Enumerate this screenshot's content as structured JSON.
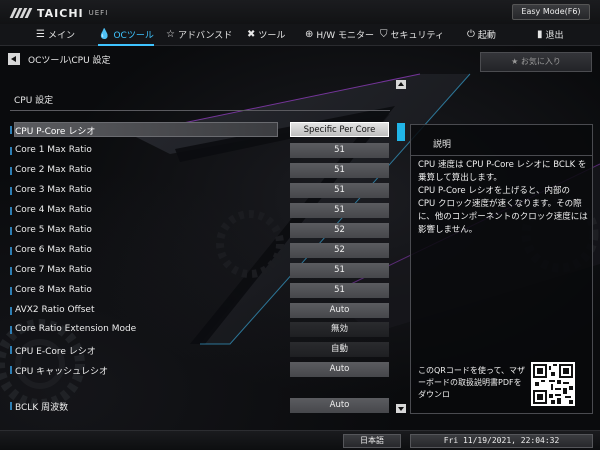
{
  "header": {
    "brand": "TAICHI",
    "brand_sub": "UEFI",
    "easy_mode_label": "Easy Mode(F6)"
  },
  "nav": [
    {
      "icon": "menu-icon",
      "label": "メイン",
      "active": false
    },
    {
      "icon": "oc-icon",
      "label": "OCツール",
      "active": true
    },
    {
      "icon": "star-icon",
      "label": "アドバンスド",
      "active": false
    },
    {
      "icon": "tools-icon",
      "label": "ツール",
      "active": false
    },
    {
      "icon": "monitor-icon",
      "label": "H/W モニター",
      "active": false
    },
    {
      "icon": "shield-icon",
      "label": "セキュリティ",
      "active": false
    },
    {
      "icon": "power-icon",
      "label": "起動",
      "active": false
    },
    {
      "icon": "exit-icon",
      "label": "退出",
      "active": false
    }
  ],
  "breadcrumb": "OCツール\\CPU 設定",
  "favorite_label": "★  お気に入り",
  "section_title": "CPU 設定",
  "settings": [
    {
      "label": "CPU P-Core レシオ",
      "value": "Specific Per Core",
      "selected": true
    },
    {
      "label": "Core 1 Max Ratio",
      "value": "51"
    },
    {
      "label": "Core 2 Max Ratio",
      "value": "51"
    },
    {
      "label": "Core 3 Max Ratio",
      "value": "51"
    },
    {
      "label": "Core 4 Max Ratio",
      "value": "51"
    },
    {
      "label": "Core 5 Max Ratio",
      "value": "52"
    },
    {
      "label": "Core 6 Max Ratio",
      "value": "52"
    },
    {
      "label": "Core 7 Max Ratio",
      "value": "51"
    },
    {
      "label": "Core 8 Max Ratio",
      "value": "51"
    },
    {
      "label": "AVX2 Ratio Offset",
      "value": "Auto"
    },
    {
      "label": "Core Ratio Extension Mode",
      "value": "無効",
      "dark": true
    },
    {
      "label": "CPU E-Core レシオ",
      "value": "自動",
      "dark": true
    },
    {
      "label": "CPU  キャッシュレシオ",
      "value": "Auto"
    },
    {
      "label": "BCLK 周波数",
      "value": "Auto"
    }
  ],
  "description": {
    "title": "説明",
    "body": "CPU 速度は CPU P-Core レシオに BCLK を乗算して算出します。\nCPU P-Core レシオを上げると、内部の CPU クロック速度が速くなります。その際に、他のコンポーネントのクロック速度には影響しません。",
    "qr_text": "このQRコードを使って、マザーボードの取扱説明書PDFをダウンロ"
  },
  "footer": {
    "language": "日本語",
    "datetime": "Fri 11/19/2021, 22:04:32"
  },
  "colors": {
    "accent": "#3fc4ff",
    "marker": "#2e7fb5"
  }
}
